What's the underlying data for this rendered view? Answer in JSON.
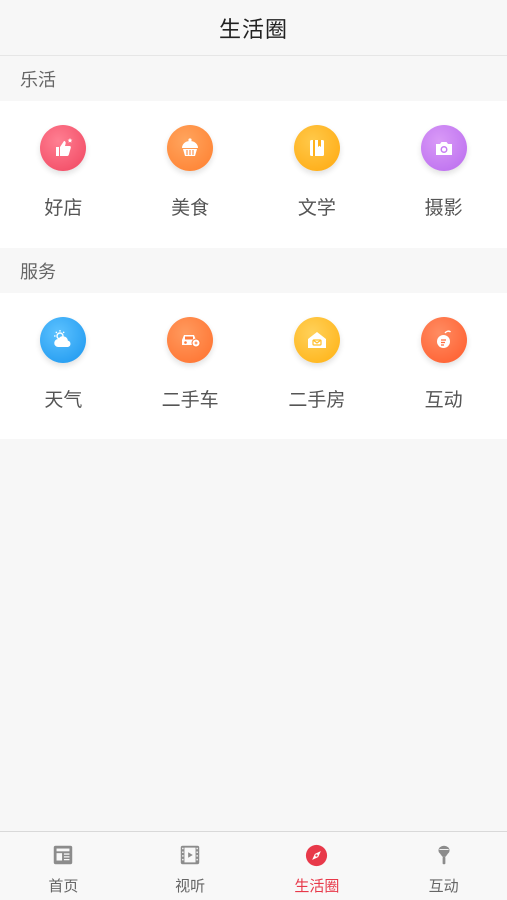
{
  "header": {
    "title": "生活圈"
  },
  "sections": [
    {
      "title": "乐活",
      "items": [
        {
          "label": "好店",
          "icon": "thumbs-up-icon",
          "color": "#f45a72"
        },
        {
          "label": "美食",
          "icon": "cupcake-icon",
          "color": "#ff8a3c"
        },
        {
          "label": "文学",
          "icon": "book-icon",
          "color": "#ffb21e"
        },
        {
          "label": "摄影",
          "icon": "camera-icon",
          "color": "#c77cf2"
        }
      ]
    },
    {
      "title": "服务",
      "items": [
        {
          "label": "天气",
          "icon": "weather-icon",
          "color": "#27a5f6"
        },
        {
          "label": "二手车",
          "icon": "car-icon",
          "color": "#ff7b3b"
        },
        {
          "label": "二手房",
          "icon": "house-icon",
          "color": "#ffbf2a"
        },
        {
          "label": "互动",
          "icon": "bubble-icon",
          "color": "#ff6b3d"
        }
      ]
    }
  ],
  "tabbar": {
    "items": [
      {
        "label": "首页",
        "icon": "news-icon"
      },
      {
        "label": "视听",
        "icon": "film-icon"
      },
      {
        "label": "生活圈",
        "icon": "compass-icon",
        "active": true
      },
      {
        "label": "互动",
        "icon": "microphone-icon"
      }
    ],
    "active_color": "#e8394a",
    "inactive_color": "#8c8c8c"
  }
}
